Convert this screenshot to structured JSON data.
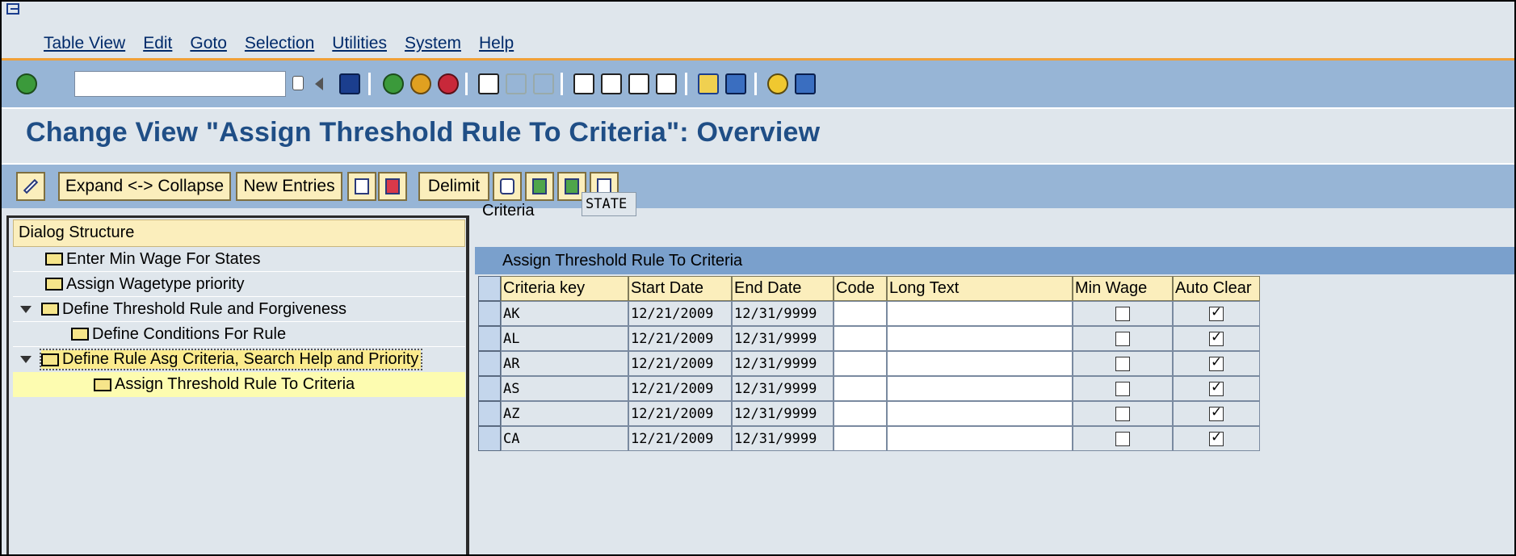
{
  "menu": {
    "items": [
      "Table View",
      "Edit",
      "Goto",
      "Selection",
      "Utilities",
      "System",
      "Help"
    ]
  },
  "toolbar": {
    "command_field_value": "",
    "icons": [
      "enter-icon",
      "command-history-icon",
      "back-arrow-icon",
      "save-icon",
      "back-icon",
      "exit-icon",
      "cancel-icon",
      "print-icon",
      "find-icon",
      "find-next-icon",
      "first-page-icon",
      "previous-page-icon",
      "next-page-icon",
      "last-page-icon",
      "new-session-icon",
      "create-shortcut-icon",
      "help-icon",
      "layout-menu-icon"
    ]
  },
  "page": {
    "title": "Change View \"Assign Threshold Rule To Criteria\": Overview"
  },
  "app_toolbar": {
    "expand_collapse": "Expand <-> Collapse",
    "new_entries": "New Entries",
    "delimit": "Delimit"
  },
  "dialog_structure": {
    "header": "Dialog Structure",
    "items": [
      {
        "label": "Enter Min Wage For States",
        "level": 0,
        "expander": false
      },
      {
        "label": "Assign Wagetype priority",
        "level": 0,
        "expander": false
      },
      {
        "label": "Define Threshold Rule and Forgiveness",
        "level": 0,
        "expander": true
      },
      {
        "label": "Define Conditions For Rule",
        "level": 1,
        "expander": false
      },
      {
        "label": "Define Rule Asg Criteria, Search Help and Priority",
        "level": 0,
        "expander": true
      },
      {
        "label": "Assign Threshold Rule To Criteria",
        "level": 1,
        "expander": false
      }
    ]
  },
  "criteria": {
    "label": "Criteria",
    "value": "STATE"
  },
  "table": {
    "caption": "Assign Threshold Rule To Criteria",
    "columns": [
      "Criteria key",
      "Start Date",
      "End Date",
      "Code",
      "Long Text",
      "Min Wage",
      "Auto Clear"
    ],
    "rows": [
      {
        "key": "AK",
        "start": "12/21/2009",
        "end": "12/31/9999",
        "code": "",
        "long_text": "",
        "min_wage": false,
        "auto_clear": true
      },
      {
        "key": "AL",
        "start": "12/21/2009",
        "end": "12/31/9999",
        "code": "",
        "long_text": "",
        "min_wage": false,
        "auto_clear": true
      },
      {
        "key": "AR",
        "start": "12/21/2009",
        "end": "12/31/9999",
        "code": "",
        "long_text": "",
        "min_wage": false,
        "auto_clear": true
      },
      {
        "key": "AS",
        "start": "12/21/2009",
        "end": "12/31/9999",
        "code": "",
        "long_text": "",
        "min_wage": false,
        "auto_clear": true
      },
      {
        "key": "AZ",
        "start": "12/21/2009",
        "end": "12/31/9999",
        "code": "",
        "long_text": "",
        "min_wage": false,
        "auto_clear": true
      },
      {
        "key": "CA",
        "start": "12/21/2009",
        "end": "12/31/9999",
        "code": "",
        "long_text": "",
        "min_wage": false,
        "auto_clear": true
      }
    ]
  },
  "colors": {
    "header_blue": "#97b5d6",
    "title_text": "#1f4e86",
    "button_fill": "#fbeebc",
    "accent_orange": "#f0a038"
  }
}
